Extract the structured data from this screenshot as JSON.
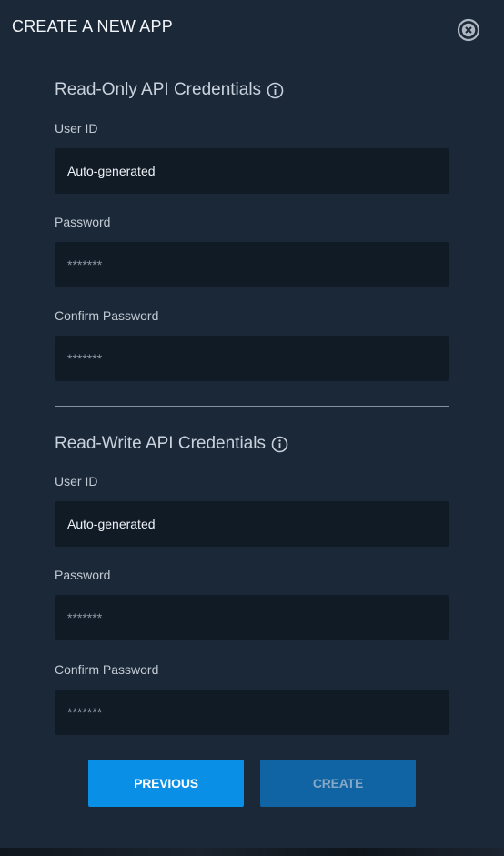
{
  "modal": {
    "title": "CREATE A NEW APP",
    "close_icon": "close-circle-icon"
  },
  "read_only": {
    "heading": "Read-Only API Credentials",
    "info_icon": "info-icon",
    "user_id": {
      "label": "User ID",
      "value": "Auto-generated"
    },
    "password": {
      "label": "Password",
      "placeholder": "*******"
    },
    "confirm_password": {
      "label": "Confirm Password",
      "placeholder": "*******"
    }
  },
  "read_write": {
    "heading": "Read-Write API Credentials",
    "info_icon": "info-icon",
    "user_id": {
      "label": "User ID",
      "value": "Auto-generated"
    },
    "password": {
      "label": "Password",
      "placeholder": "*******"
    },
    "confirm_password": {
      "label": "Confirm Password",
      "placeholder": "*******"
    }
  },
  "actions": {
    "previous_label": "PREVIOUS",
    "create_label": "CREATE"
  },
  "colors": {
    "background": "#1b2838",
    "field_background": "#111b26",
    "primary_button": "#0a8fe6",
    "disabled_button": "#1064a3"
  }
}
